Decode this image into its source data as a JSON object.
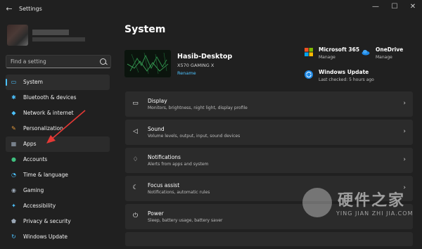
{
  "window": {
    "title": "Settings",
    "back_glyph": "←",
    "minimize_glyph": "—",
    "maximize_glyph": "☐",
    "close_glyph": "✕"
  },
  "search": {
    "placeholder": "Find a setting"
  },
  "sidebar": {
    "items": [
      {
        "label": "System",
        "icon": "monitor-icon",
        "glyph": "▭",
        "color": "#4cc2ff"
      },
      {
        "label": "Bluetooth & devices",
        "icon": "bluetooth-icon",
        "glyph": "✱",
        "color": "#4cc2ff"
      },
      {
        "label": "Network & internet",
        "icon": "wifi-icon",
        "glyph": "◆",
        "color": "#4cc2ff"
      },
      {
        "label": "Personalization",
        "icon": "brush-icon",
        "glyph": "✎",
        "color": "#e59a3c"
      },
      {
        "label": "Apps",
        "icon": "apps-icon",
        "glyph": "▦",
        "color": "#9aa7b6"
      },
      {
        "label": "Accounts",
        "icon": "person-icon",
        "glyph": "●",
        "color": "#3fbf7f"
      },
      {
        "label": "Time & language",
        "icon": "globe-clock-icon",
        "glyph": "◔",
        "color": "#4cc2ff"
      },
      {
        "label": "Gaming",
        "icon": "gamepad-icon",
        "glyph": "◉",
        "color": "#9aa7b6"
      },
      {
        "label": "Accessibility",
        "icon": "accessibility-icon",
        "glyph": "✦",
        "color": "#4cc2ff"
      },
      {
        "label": "Privacy & security",
        "icon": "shield-icon",
        "glyph": "⬟",
        "color": "#9aa7b6"
      },
      {
        "label": "Windows Update",
        "icon": "update-icon",
        "glyph": "↻",
        "color": "#4cc2ff"
      }
    ]
  },
  "main": {
    "title": "System",
    "device": {
      "name": "Hasib-Desktop",
      "model": "X570 GAMING X",
      "rename_label": "Rename"
    },
    "quick_actions": [
      {
        "title": "Microsoft 365",
        "sub": "Manage",
        "icon": "microsoft-365-icon"
      },
      {
        "title": "OneDrive",
        "sub": "Manage",
        "icon": "onedrive-icon"
      },
      {
        "title": "Windows Update",
        "sub": "Last checked: 5 hours ago",
        "icon": "windows-update-icon"
      }
    ],
    "cards": [
      {
        "title": "Display",
        "sub": "Monitors, brightness, night light, display profile",
        "icon": "display-icon",
        "glyph": "▭"
      },
      {
        "title": "Sound",
        "sub": "Volume levels, output, input, sound devices",
        "icon": "speaker-icon",
        "glyph": "◁"
      },
      {
        "title": "Notifications",
        "sub": "Alerts from apps and system",
        "icon": "bell-icon",
        "glyph": "♢"
      },
      {
        "title": "Focus assist",
        "sub": "Notifications, automatic rules",
        "icon": "moon-icon",
        "glyph": "☾"
      },
      {
        "title": "Power",
        "sub": "Sleep, battery usage, battery saver",
        "icon": "power-icon",
        "glyph": "⏻"
      }
    ],
    "chevron": "›"
  },
  "watermark": {
    "text": "硬件之家",
    "sub": "YING JIAN ZHI JIA.COM"
  },
  "colors": {
    "accent": "#4cc2ff",
    "background": "#202020",
    "card": "#2b2b2b",
    "annotation_arrow": "#e53935"
  }
}
